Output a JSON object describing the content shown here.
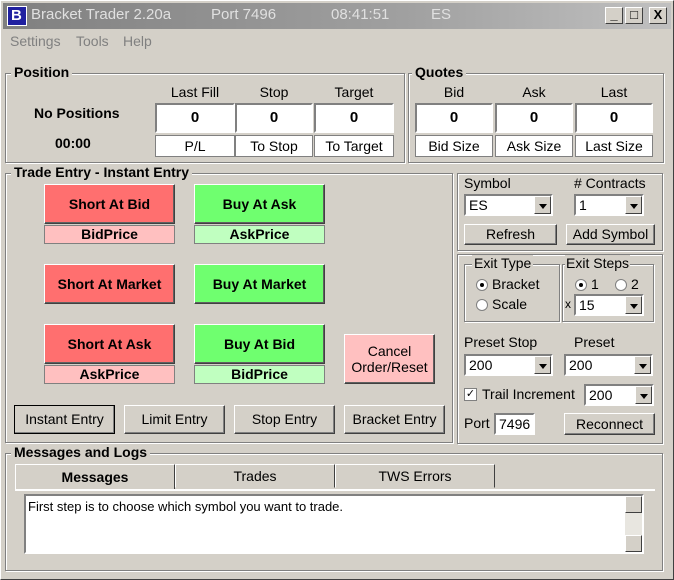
{
  "window": {
    "app_title": "Bracket Trader 2.20a",
    "port_label": "Port 7496",
    "time": "08:41:51",
    "symbol": "ES",
    "minimize": "_",
    "maximize": "□",
    "close": "X"
  },
  "menu": [
    "Settings",
    "Tools",
    "Help"
  ],
  "position": {
    "group_label": "Position",
    "status": "No Positions",
    "timer": "00:00",
    "headers": [
      "Last Fill",
      "Stop",
      "Target"
    ],
    "values": [
      "0",
      "0",
      "0"
    ],
    "sublabels": [
      "P/L",
      "To Stop",
      "To Target"
    ]
  },
  "quotes": {
    "group_label": "Quotes",
    "headers": [
      "Bid",
      "Ask",
      "Last"
    ],
    "values": [
      "0",
      "0",
      "0"
    ],
    "sublabels": [
      "Bid Size",
      "Ask Size",
      "Last Size"
    ]
  },
  "trade_entry": {
    "group_label": "Trade Entry - Instant Entry",
    "short_at_bid": "Short At Bid",
    "buy_at_ask": "Buy At Ask",
    "bid_price": "BidPrice",
    "ask_price": "AskPrice",
    "short_at_market": "Short At Market",
    "buy_at_market": "Buy At Market",
    "short_at_ask": "Short At Ask",
    "buy_at_bid": "Buy At Bid",
    "ask_price2": "AskPrice",
    "bid_price2": "BidPrice",
    "cancel_line1": "Cancel",
    "cancel_line2": "Order/Reset",
    "modes": [
      "Instant Entry",
      "Limit Entry",
      "Stop Entry",
      "Bracket Entry"
    ]
  },
  "symbol_panel": {
    "symbol_label": "Symbol",
    "contracts_label": "# Contracts",
    "symbol_value": "ES",
    "contracts_value": "1",
    "refresh": "Refresh",
    "add_symbol": "Add Symbol"
  },
  "exit_panel": {
    "exit_type_label": "Exit Type",
    "bracket": "Bracket",
    "scale": "Scale",
    "exit_steps_label": "Exit Steps",
    "step1": "1",
    "step2": "2",
    "x_label": "x",
    "steps_value": "15",
    "preset_stop_label": "Preset Stop",
    "preset_label": "Preset",
    "preset_stop_value": "200",
    "preset_value": "200",
    "trail_label": "Trail Increment",
    "trail_checked": "✓",
    "trail_value": "200",
    "port_label": "Port",
    "port_value": "7496",
    "reconnect": "Reconnect"
  },
  "messages": {
    "group_label": "Messages and Logs",
    "tabs": [
      "Messages",
      "Trades",
      "TWS Errors"
    ],
    "text": "First step is to choose which symbol you want to trade."
  }
}
